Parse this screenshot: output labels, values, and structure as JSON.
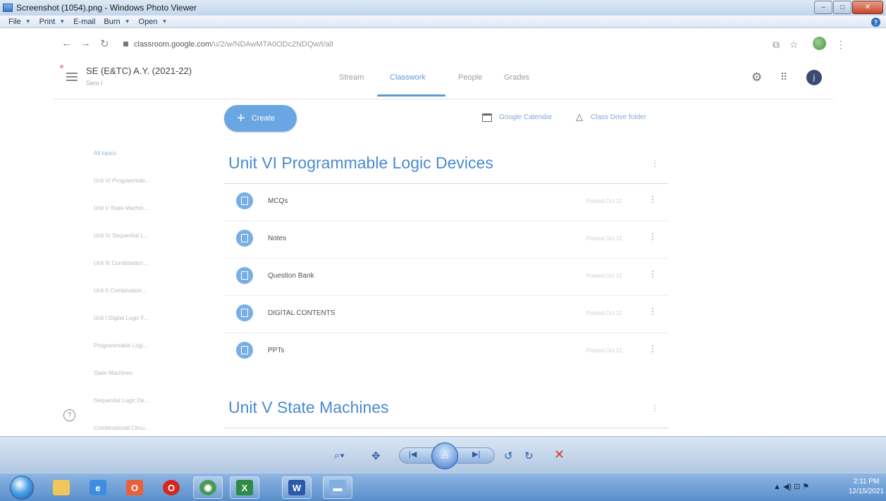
{
  "window": {
    "title": "Screenshot (1054).png - Windows Photo Viewer",
    "min_glyph": "–",
    "max_glyph": "□",
    "close_glyph": "✕",
    "help_glyph": "?"
  },
  "photo_viewer_menu": [
    {
      "label": "File",
      "has_dropdown": true
    },
    {
      "label": "Print",
      "has_dropdown": true
    },
    {
      "label": "E-mail",
      "has_dropdown": false
    },
    {
      "label": "Burn",
      "has_dropdown": true
    },
    {
      "label": "Open",
      "has_dropdown": true
    }
  ],
  "browser": {
    "url_host": "classroom.google.com",
    "url_path": "/u/2/w/NDAwMTA0ODc2NDQw/t/all"
  },
  "classroom": {
    "class_title": "SE (E&TC) A.Y. (2021-22)",
    "class_subtitle": "Sem I",
    "tabs": [
      {
        "label": "Stream",
        "active": false
      },
      {
        "label": "Classwork",
        "active": true
      },
      {
        "label": "People",
        "active": false
      },
      {
        "label": "Grades",
        "active": false
      }
    ],
    "avatar_letter": "j",
    "create_label": "Create",
    "calendar_label": "Google Calendar",
    "drive_label": "Class Drive folder",
    "help_glyph": "?"
  },
  "topics": [
    "All topics",
    "Unit VI Programmab...",
    "Unit V State Machin...",
    "Unit IV Sequential L...",
    "Unit III Combination...",
    "Unit II Combination...",
    "Unit I Digital Logic F...",
    "Programmable Logi...",
    "State Machines",
    "Sequential Logic De...",
    "Combinational Circu..."
  ],
  "sections": [
    {
      "title": "Unit VI Programmable Logic Devices",
      "materials": [
        {
          "title": "MCQs",
          "date": "Posted Oct 12"
        },
        {
          "title": "Notes",
          "date": "Posted Oct 12"
        },
        {
          "title": "Question Bank",
          "date": "Posted Oct 12"
        },
        {
          "title": "DIGITAL CONTENTS",
          "date": "Posted Oct 12"
        },
        {
          "title": "PPTs",
          "date": "Posted Oct 12"
        }
      ]
    },
    {
      "title": "Unit V State Machines",
      "materials": []
    }
  ],
  "taskbar": {
    "apps": [
      {
        "name": "file-explorer",
        "color": "#f1c75b",
        "glyph": ""
      },
      {
        "name": "internet-explorer",
        "color": "#3e8de0",
        "glyph": "e"
      },
      {
        "name": "office",
        "color": "#e8613b",
        "glyph": "O"
      },
      {
        "name": "opera",
        "color": "#d7261e",
        "glyph": "O"
      },
      {
        "name": "chrome",
        "color": "#4c9a55",
        "glyph": "◉"
      },
      {
        "name": "excel",
        "color": "#2f8a47",
        "glyph": "X"
      },
      {
        "name": "word",
        "color": "#2b5aa8",
        "glyph": "W"
      },
      {
        "name": "photo-viewer",
        "color": "#7fb0de",
        "glyph": "▬"
      }
    ],
    "time": "2:11 PM",
    "date": "12/15/2021"
  }
}
